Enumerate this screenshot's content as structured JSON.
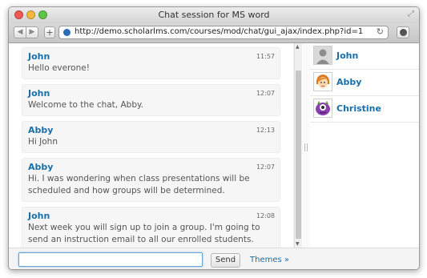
{
  "window": {
    "title": "Chat session for MS word",
    "url": "http://demo.scholarlms.com/courses/mod/chat/gui_ajax/index.php?id=1"
  },
  "messages": [
    {
      "user": "John",
      "time": "11:57",
      "text": "Hello everone!"
    },
    {
      "user": "John",
      "time": "12:07",
      "text": "Welcome to the chat, Abby."
    },
    {
      "user": "Abby",
      "time": "12:13",
      "text": "Hi John"
    },
    {
      "user": "Abby",
      "time": "12:07",
      "text": "Hi. I was wondering when class presentations will be scheduled and how groups will be determined."
    },
    {
      "user": "John",
      "time": "12:08",
      "text": "Next week you will sign up to join a group. I'm going to send an instruction email to all our enrolled students."
    }
  ],
  "users": [
    {
      "name": "John",
      "avatar": "default-user-icon"
    },
    {
      "name": "Abby",
      "avatar": "abby-avatar-icon"
    },
    {
      "name": "Christine",
      "avatar": "purple-monster-avatar-icon"
    }
  ],
  "composer": {
    "input_value": "",
    "send_label": "Send",
    "themes_label": "Themes »"
  },
  "colors": {
    "link_blue": "#1a6fa8",
    "input_focus": "#6aa3d6"
  }
}
